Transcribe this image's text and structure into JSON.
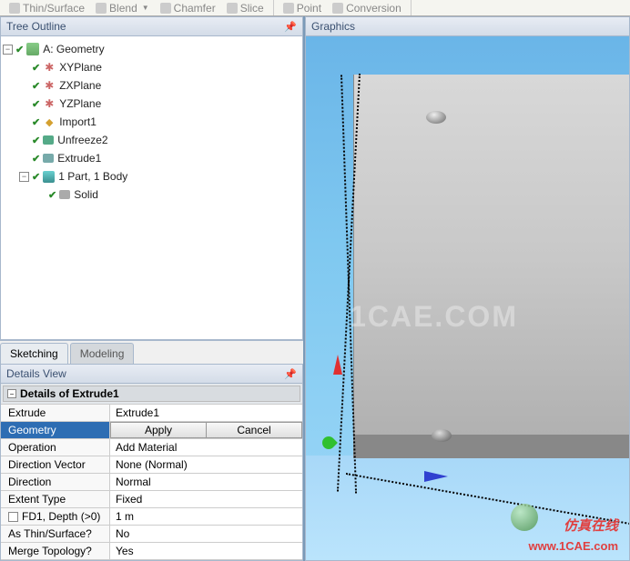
{
  "toolbar": {
    "thin_surface": "Thin/Surface",
    "blend": "Blend",
    "chamfer": "Chamfer",
    "slice": "Slice",
    "point": "Point",
    "conversion": "Conversion"
  },
  "panels": {
    "tree_outline": "Tree Outline",
    "graphics": "Graphics",
    "details_view": "Details View"
  },
  "tree": {
    "root": "A: Geometry",
    "xyplane": "XYPlane",
    "zxplane": "ZXPlane",
    "yzplane": "YZPlane",
    "import1": "Import1",
    "unfreeze2": "Unfreeze2",
    "extrude1": "Extrude1",
    "parts": "1 Part, 1 Body",
    "solid": "Solid"
  },
  "tabs": {
    "sketching": "Sketching",
    "modeling": "Modeling"
  },
  "details": {
    "title": "Details of Extrude1",
    "rows": {
      "extrude_label": "Extrude",
      "extrude_value": "Extrude1",
      "geometry_label": "Geometry",
      "apply": "Apply",
      "cancel": "Cancel",
      "operation_label": "Operation",
      "operation_value": "Add Material",
      "direction_vector_label": "Direction Vector",
      "direction_vector_value": "None (Normal)",
      "direction_label": "Direction",
      "direction_value": "Normal",
      "extent_type_label": "Extent Type",
      "extent_type_value": "Fixed",
      "depth_label": "FD1,  Depth (>0)",
      "depth_value": "1 m",
      "thin_label": "As Thin/Surface?",
      "thin_value": "No",
      "merge_label": "Merge Topology?",
      "merge_value": "Yes"
    }
  },
  "watermarks": {
    "center": "1CAE.COM",
    "br_text": "仿真在线",
    "br_url": "www.1CAE.com"
  }
}
